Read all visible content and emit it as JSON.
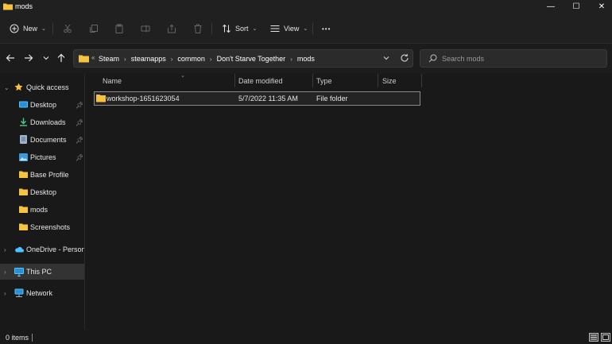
{
  "window": {
    "title": "mods",
    "minimize_glyph": "—",
    "maximize_glyph": "☐",
    "close_glyph": "✕"
  },
  "toolbar": {
    "new_label": "New",
    "sort_label": "Sort",
    "view_label": "View",
    "more_label": "•••",
    "disabled_icons": [
      "cut-icon",
      "copy-icon",
      "paste-icon",
      "rename-icon",
      "share-icon",
      "delete-icon"
    ]
  },
  "address": {
    "overflow": "«",
    "crumbs": [
      "Steam",
      "steamapps",
      "common",
      "Don't Starve Together",
      "mods"
    ],
    "separator": "›"
  },
  "search": {
    "placeholder": "Search mods"
  },
  "sidebar": {
    "quick_access": "Quick access",
    "items": [
      {
        "label": "Desktop",
        "icon": "desktop-icon",
        "pinned": true
      },
      {
        "label": "Downloads",
        "icon": "download-icon",
        "pinned": true
      },
      {
        "label": "Documents",
        "icon": "document-icon",
        "pinned": true
      },
      {
        "label": "Pictures",
        "icon": "pictures-icon",
        "pinned": true
      },
      {
        "label": "Base Profile",
        "icon": "folder-icon",
        "pinned": false
      },
      {
        "label": "Desktop",
        "icon": "folder-icon",
        "pinned": false
      },
      {
        "label": "mods",
        "icon": "folder-icon",
        "pinned": false
      },
      {
        "label": "Screenshots",
        "icon": "folder-icon",
        "pinned": false
      }
    ],
    "onedrive": "OneDrive - Personal",
    "this_pc": "This PC",
    "network": "Network"
  },
  "columns": {
    "name": "Name",
    "date": "Date modified",
    "type": "Type",
    "size": "Size"
  },
  "files": [
    {
      "name": "workshop-1651623054",
      "date": "5/7/2022 11:35 AM",
      "type": "File folder",
      "size": ""
    }
  ],
  "status": {
    "count": "0 items"
  },
  "colors": {
    "folder": "#f5c242",
    "accent": "#4cc2ff",
    "background": "#191919"
  }
}
